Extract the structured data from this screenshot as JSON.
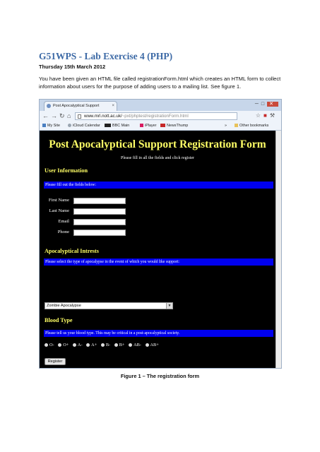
{
  "document": {
    "title": "G51WPS - Lab Exercise 4 (PHP)",
    "date": "Thursday 15th March 2012",
    "intro": "You have been given an HTML file called registrationForm.html which creates an HTML form to collect information about users for the purpose of adding users to a mailing list. See figure 1.",
    "caption": "Figure 1 – The registration form"
  },
  "browser": {
    "tab_title": "Post Apocalyptical Support",
    "tab_close": "×",
    "url_host": "www.mrl.nott.ac.uk/",
    "url_path": "~pxt/phptest/registrationForm.html",
    "bookmarks": [
      {
        "label": "My Site",
        "icon_color": "#4a7fc1"
      },
      {
        "label": "iCloud Calendar",
        "icon_color": "#9aa5b1"
      },
      {
        "label": "BBC Main",
        "icon_color": "#222222"
      },
      {
        "label": "iPlayer",
        "icon_color": "#d81b60"
      },
      {
        "label": "NewsThump",
        "icon_color": "#c62828"
      }
    ],
    "bookmarks_more": "»",
    "other_bookmarks": "Other bookmarks"
  },
  "form": {
    "title": "Post Apocalyptical Support Registration Form",
    "subtitle": "Please fill in all the fields and click register",
    "user_info": {
      "heading": "User Information",
      "bar_text": "Please fill out the fields below:",
      "fields": [
        {
          "label": "First Name"
        },
        {
          "label": "Last Name"
        },
        {
          "label": "Email"
        },
        {
          "label": "Phone"
        }
      ]
    },
    "interests": {
      "heading": "Apocalyptical Intrests",
      "bar_text": "Please select the type of apocalypse in the event of which you would like support:",
      "selected": "Zombie Apocalypse"
    },
    "blood": {
      "heading": "Blood Type",
      "bar_text": "Please tell us your blood type. This may be critical in a post-apocalyptical society.",
      "options": [
        "O-",
        "O+",
        "A-",
        "A+",
        "B-",
        "B+",
        "AB-",
        "AB+"
      ]
    },
    "register_label": "Register"
  },
  "colors": {
    "heading_yellow": "#ffff66",
    "bar_blue": "#0000ee",
    "title_blue": "#3d6aa6"
  }
}
